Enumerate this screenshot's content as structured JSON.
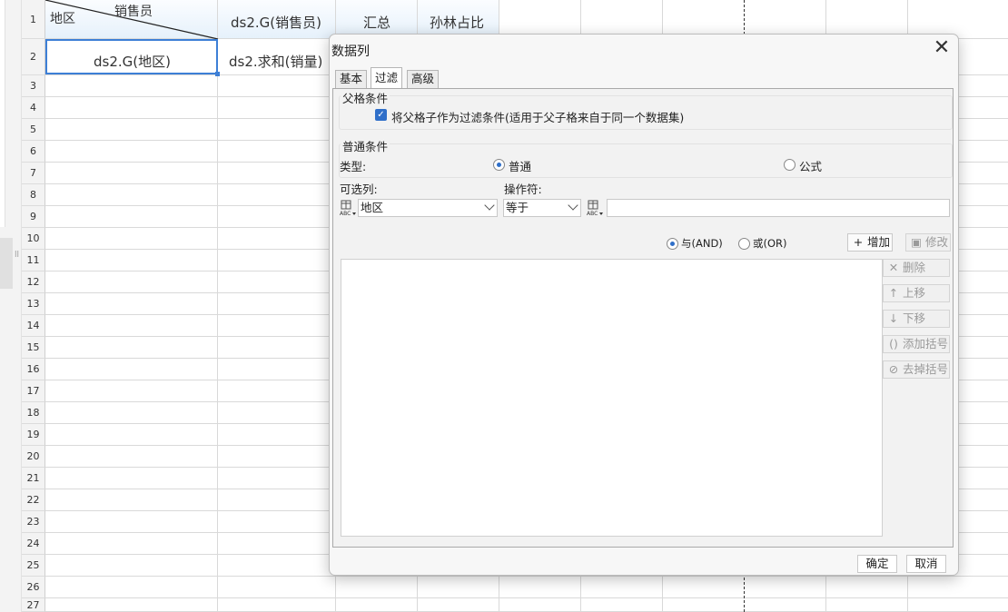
{
  "sheet": {
    "row_numbers": [
      "1",
      "2",
      "3",
      "4",
      "5",
      "6",
      "7",
      "8",
      "9",
      "10",
      "11",
      "12",
      "13",
      "14",
      "15",
      "16",
      "17",
      "18",
      "19",
      "20",
      "21",
      "22",
      "23",
      "24",
      "25",
      "26",
      "27"
    ],
    "cells": {
      "a1_region": "地区",
      "a1_salesperson": "销售员",
      "b1": "ds2.G(销售员)",
      "c1": "汇总",
      "d1": "孙林占比",
      "a2": "ds2.G(地区)",
      "b2": "ds2.求和(销量)"
    },
    "splitter_mark": "ll",
    "colors": {
      "selection": "#3d7fd6",
      "header_band": "#e6f1fb"
    }
  },
  "dialog": {
    "title": "数据列",
    "close_icon": "close-icon",
    "tabs": [
      "基本",
      "过滤",
      "高级"
    ],
    "active_tab": "过滤",
    "parent_condition": {
      "title": "父格条件",
      "checkbox_label": "将父格子作为过滤条件(适用于父子格来自于同一个数据集)",
      "checked": true
    },
    "normal_condition": {
      "title": "普通条件",
      "type_label": "类型:",
      "type_options": [
        "普通",
        "公式"
      ],
      "type_selected": "普通",
      "column_label": "可选列:",
      "column_value": "地区",
      "operator_label": "操作符:",
      "operator_value": "等于",
      "value_input": "",
      "logic_options": [
        "与(AND)",
        "或(OR)"
      ],
      "logic_selected": "与(AND)",
      "add_button": "增加",
      "modify_button": "修改"
    },
    "side_buttons": {
      "delete": "删除",
      "move_up": "上移",
      "move_down": "下移",
      "add_bracket": "添加括号",
      "remove_bracket": "去掉括号"
    },
    "ok_button": "确定",
    "cancel_button": "取消"
  }
}
